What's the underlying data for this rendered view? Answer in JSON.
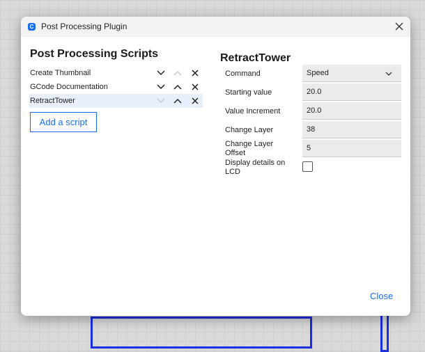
{
  "window": {
    "title": "Post Processing Plugin",
    "icon": "cura-app-icon"
  },
  "left_panel": {
    "heading": "Post Processing Scripts",
    "scripts": [
      {
        "label": "Create Thumbnail",
        "up_enabled": false,
        "down_enabled": true
      },
      {
        "label": "GCode Documentation",
        "up_enabled": true,
        "down_enabled": true
      },
      {
        "label": "RetractTower",
        "up_enabled": true,
        "down_enabled": false,
        "selected": true
      }
    ],
    "add_button": "Add a script"
  },
  "right_panel": {
    "heading": "RetractTower",
    "settings": [
      {
        "label": "Command",
        "value": "Speed",
        "type": "dropdown"
      },
      {
        "label": "Starting value",
        "value": "20.0"
      },
      {
        "label": "Value Increment",
        "value": "20.0"
      },
      {
        "label": "Change Layer",
        "value": "38"
      },
      {
        "label": "Change Layer Offset",
        "value": "5"
      },
      {
        "label": "Display details on LCD",
        "value": false,
        "type": "checkbox"
      }
    ]
  },
  "footer": {
    "close_label": "Close"
  },
  "colors": {
    "accent": "#196ef0",
    "background_frame": "#1b2ee0"
  }
}
